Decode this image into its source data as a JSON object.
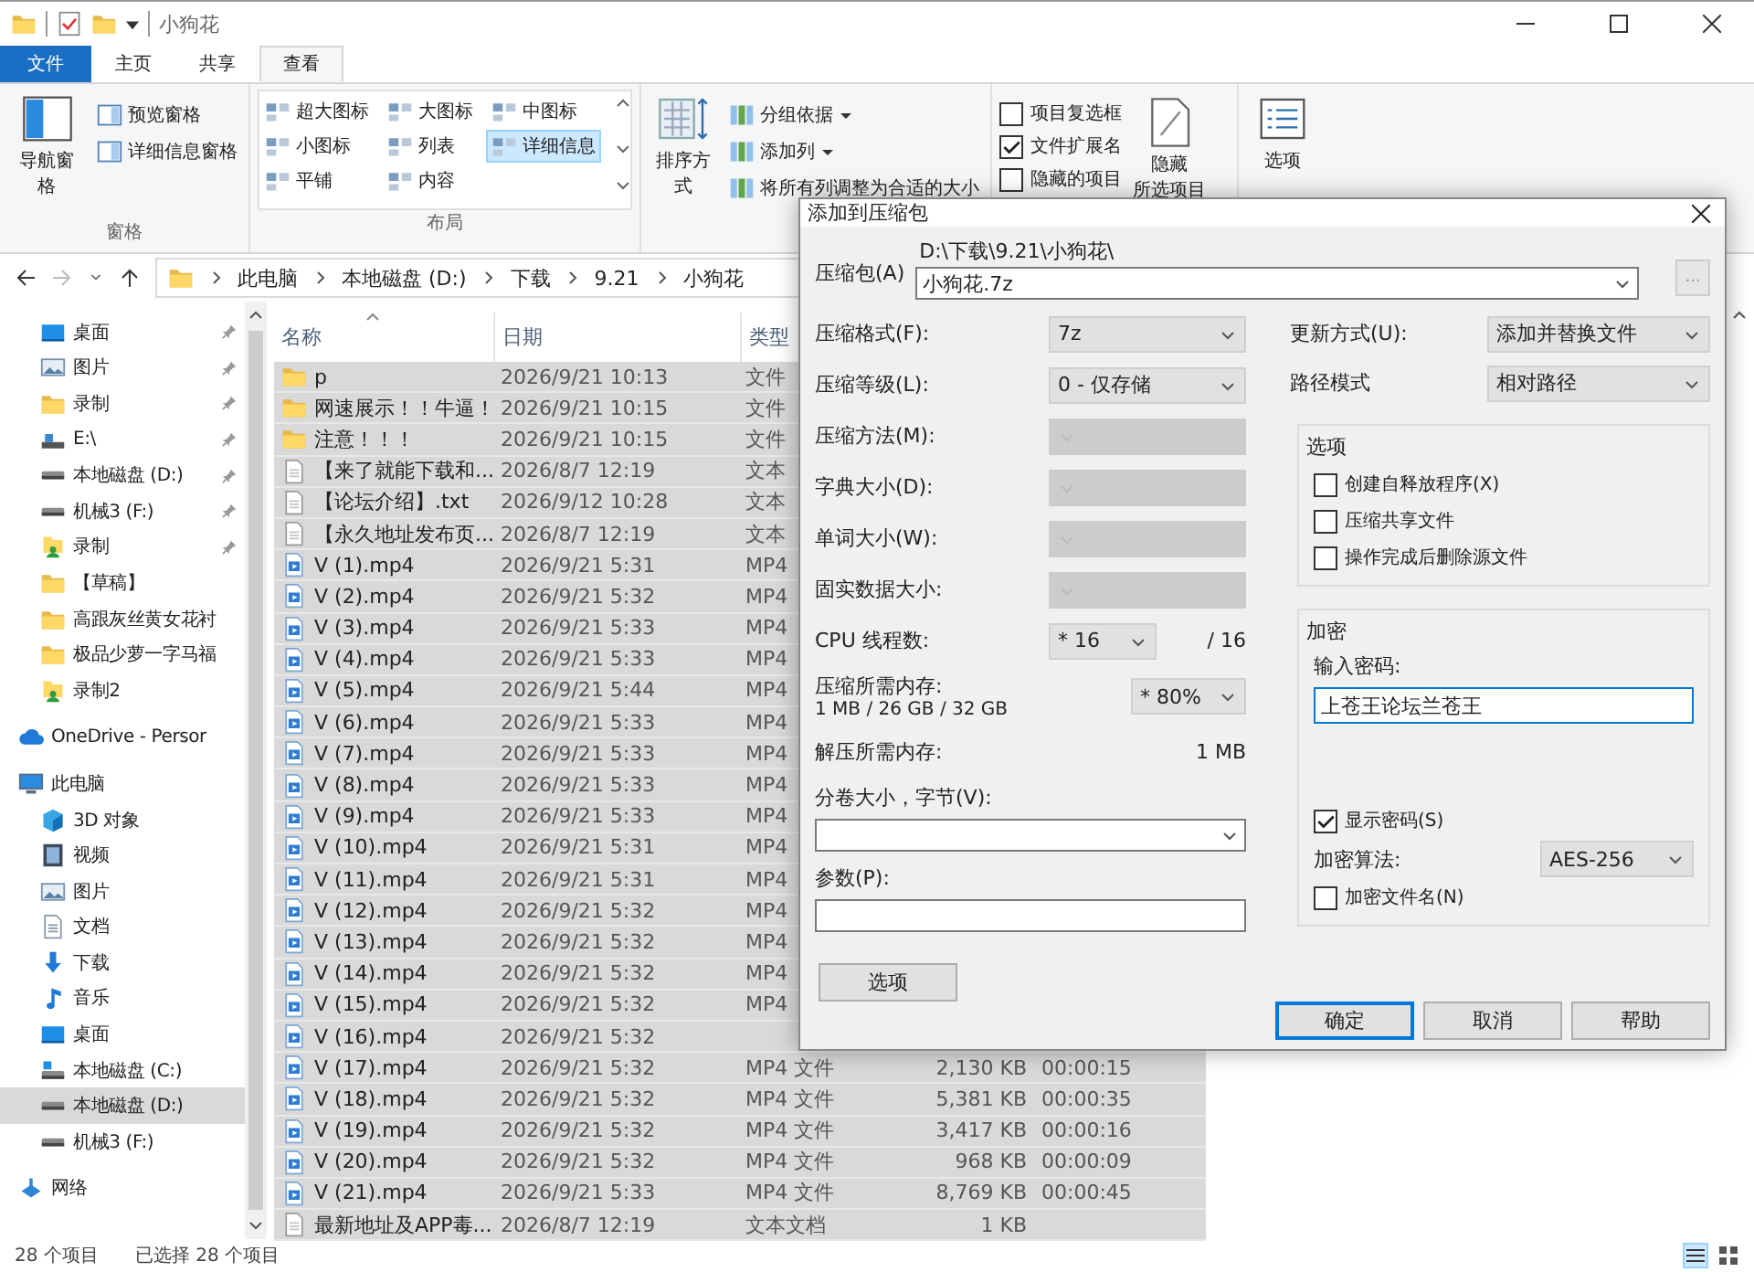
{
  "window": {
    "title": "小狗花"
  },
  "ribbon": {
    "tabs": [
      {
        "label": "文件",
        "kind": "file",
        "selected": false
      },
      {
        "label": "主页",
        "kind": "tab",
        "selected": false
      },
      {
        "label": "共享",
        "kind": "tab",
        "selected": false
      },
      {
        "label": "查看",
        "kind": "tab",
        "selected": true
      }
    ],
    "panes": {
      "label": "窗格",
      "large": "导航窗格",
      "items": [
        "预览窗格",
        "详细信息窗格"
      ]
    },
    "layout": {
      "label": "布局",
      "items": [
        {
          "label": "超大图标",
          "selected": false
        },
        {
          "label": "大图标",
          "selected": false
        },
        {
          "label": "中图标",
          "selected": false
        },
        {
          "label": "小图标",
          "selected": false
        },
        {
          "label": "列表",
          "selected": false
        },
        {
          "label": "详细信息",
          "selected": true
        },
        {
          "label": "平铺",
          "selected": false
        },
        {
          "label": "内容",
          "selected": false
        }
      ]
    },
    "current_view": {
      "sort": "排序方式",
      "items": [
        {
          "label": "分组依据",
          "dropdown": true
        },
        {
          "label": "添加列",
          "dropdown": true
        },
        {
          "label": "将所有列调整为合适的大小",
          "dropdown": false
        }
      ]
    },
    "show_hide": {
      "checkboxes": [
        {
          "label": "项目复选框",
          "checked": false
        },
        {
          "label": "文件扩展名",
          "checked": true
        },
        {
          "label": "隐藏的项目",
          "checked": false
        }
      ],
      "hide_button": [
        "隐藏",
        "所选项目"
      ]
    },
    "options": "选项"
  },
  "address": {
    "crumbs": [
      "此电脑",
      "本地磁盘 (D:)",
      "下载",
      "9.21",
      "小狗花"
    ]
  },
  "nav": {
    "quick_access": [
      {
        "label": "桌面",
        "kind": "desktop",
        "pinned": true,
        "selected": false
      },
      {
        "label": "图片",
        "kind": "pictures",
        "pinned": true,
        "selected": false
      },
      {
        "label": "录制",
        "kind": "folder",
        "pinned": true,
        "selected": false
      },
      {
        "label": "E:\\",
        "kind": "usb",
        "pinned": true,
        "selected": false
      },
      {
        "label": "本地磁盘 (D:)",
        "kind": "drive",
        "pinned": true,
        "selected": false
      },
      {
        "label": "机械3 (F:)",
        "kind": "drive",
        "pinned": true,
        "selected": false
      },
      {
        "label": "录制",
        "kind": "shared",
        "pinned": true,
        "selected": false
      },
      {
        "label": "【草稿】",
        "kind": "folder",
        "pinned": false,
        "selected": false
      },
      {
        "label": "高跟灰丝黄女花衬",
        "kind": "folder",
        "pinned": false,
        "selected": false
      },
      {
        "label": "极品少萝一字马福",
        "kind": "folder",
        "pinned": false,
        "selected": false
      },
      {
        "label": "录制2",
        "kind": "shared",
        "pinned": false,
        "selected": false
      }
    ],
    "tree": [
      {
        "label": "OneDrive - Persor",
        "kind": "cloud",
        "selected": false
      },
      {
        "label": "此电脑",
        "kind": "pc",
        "selected": false,
        "children": [
          {
            "label": "3D 对象",
            "kind": "cube",
            "selected": false
          },
          {
            "label": "视频",
            "kind": "film",
            "selected": false
          },
          {
            "label": "图片",
            "kind": "pictures",
            "selected": false
          },
          {
            "label": "文档",
            "kind": "document",
            "selected": false
          },
          {
            "label": "下载",
            "kind": "download",
            "selected": false
          },
          {
            "label": "音乐",
            "kind": "music",
            "selected": false
          },
          {
            "label": "桌面",
            "kind": "desktop",
            "selected": false
          },
          {
            "label": "本地磁盘 (C:)",
            "kind": "system",
            "selected": false
          },
          {
            "label": "本地磁盘 (D:)",
            "kind": "drive",
            "selected": true
          },
          {
            "label": "机械3 (F:)",
            "kind": "drive",
            "selected": false
          }
        ]
      },
      {
        "label": "网络",
        "kind": "network",
        "selected": false
      }
    ]
  },
  "files": {
    "columns": [
      {
        "label": "名称",
        "sorted": true
      },
      {
        "label": "日期",
        "sorted": false
      },
      {
        "label": "类型",
        "sorted": false
      }
    ],
    "rows": [
      {
        "name": "p",
        "kind": "folder",
        "date": "2026/9/21 10:13",
        "type": "文件",
        "selected": true
      },
      {
        "name": "网速展示！！牛逼！",
        "kind": "folder",
        "date": "2026/9/21 10:15",
        "type": "文件",
        "selected": true
      },
      {
        "name": "注意！！！",
        "kind": "folder",
        "date": "2026/9/21 10:15",
        "type": "文件",
        "selected": true
      },
      {
        "name": "【来了就能下载和...",
        "kind": "text",
        "date": "2026/8/7 12:19",
        "type": "文本",
        "selected": true
      },
      {
        "name": "【论坛介绍】.txt",
        "kind": "text",
        "date": "2026/9/12 10:28",
        "type": "文本",
        "selected": true
      },
      {
        "name": "【永久地址发布页...",
        "kind": "text",
        "date": "2026/8/7 12:19",
        "type": "文本",
        "selected": true
      },
      {
        "name": "V (1).mp4",
        "kind": "video",
        "date": "2026/9/21 5:31",
        "type": "MP4",
        "selected": true
      },
      {
        "name": "V (2).mp4",
        "kind": "video",
        "date": "2026/9/21 5:32",
        "type": "MP4",
        "selected": true
      },
      {
        "name": "V (3).mp4",
        "kind": "video",
        "date": "2026/9/21 5:33",
        "type": "MP4",
        "selected": true
      },
      {
        "name": "V (4).mp4",
        "kind": "video",
        "date": "2026/9/21 5:33",
        "type": "MP4",
        "selected": true
      },
      {
        "name": "V (5).mp4",
        "kind": "video",
        "date": "2026/9/21 5:44",
        "type": "MP4",
        "selected": true
      },
      {
        "name": "V (6).mp4",
        "kind": "video",
        "date": "2026/9/21 5:33",
        "type": "MP4",
        "selected": true
      },
      {
        "name": "V (7).mp4",
        "kind": "video",
        "date": "2026/9/21 5:33",
        "type": "MP4",
        "selected": true
      },
      {
        "name": "V (8).mp4",
        "kind": "video",
        "date": "2026/9/21 5:33",
        "type": "MP4",
        "selected": true
      },
      {
        "name": "V (9).mp4",
        "kind": "video",
        "date": "2026/9/21 5:33",
        "type": "MP4",
        "selected": true
      },
      {
        "name": "V (10).mp4",
        "kind": "video",
        "date": "2026/9/21 5:31",
        "type": "MP4",
        "selected": true
      },
      {
        "name": "V (11).mp4",
        "kind": "video",
        "date": "2026/9/21 5:31",
        "type": "MP4",
        "selected": true
      },
      {
        "name": "V (12).mp4",
        "kind": "video",
        "date": "2026/9/21 5:32",
        "type": "MP4",
        "selected": true
      },
      {
        "name": "V (13).mp4",
        "kind": "video",
        "date": "2026/9/21 5:32",
        "type": "MP4",
        "selected": true
      },
      {
        "name": "V (14).mp4",
        "kind": "video",
        "date": "2026/9/21 5:32",
        "type": "MP4",
        "selected": true
      },
      {
        "name": "V (15).mp4",
        "kind": "video",
        "date": "2026/9/21 5:32",
        "type": "MP4",
        "selected": true
      },
      {
        "name": "V (16).mp4",
        "kind": "video",
        "date": "2026/9/21 5:32",
        "selected": true
      },
      {
        "name": "V (17).mp4",
        "kind": "video",
        "date": "2026/9/21 5:32",
        "type": "MP4 文件",
        "size": "2,130 KB",
        "duration": "00:00:15",
        "selected": true
      },
      {
        "name": "V (18).mp4",
        "kind": "video",
        "date": "2026/9/21 5:32",
        "type": "MP4 文件",
        "size": "5,381 KB",
        "duration": "00:00:35",
        "selected": true
      },
      {
        "name": "V (19).mp4",
        "kind": "video",
        "date": "2026/9/21 5:32",
        "type": "MP4 文件",
        "size": "3,417 KB",
        "duration": "00:00:16",
        "selected": true
      },
      {
        "name": "V (20).mp4",
        "kind": "video",
        "date": "2026/9/21 5:32",
        "type": "MP4 文件",
        "size": "968 KB",
        "duration": "00:00:09",
        "selected": true
      },
      {
        "name": "V (21).mp4",
        "kind": "video",
        "date": "2026/9/21 5:33",
        "type": "MP4 文件",
        "size": "8,769 KB",
        "duration": "00:00:45",
        "selected": true
      },
      {
        "name": "最新地址及APP毒...",
        "kind": "text",
        "date": "2026/8/7 12:19",
        "type": "文本文档",
        "size": "1 KB",
        "selected": true
      }
    ]
  },
  "status_bar": {
    "count": "28 个项目",
    "selection": "已选择 28 个项目"
  },
  "dialog": {
    "title": "添加到压缩包",
    "archive": {
      "label": "压缩包(A)",
      "path": "D:\\下载\\9.21\\小狗花\\",
      "value": "小狗花.7z",
      "browse": "..."
    },
    "left_fields": [
      {
        "kind": "select",
        "label": "压缩格式(F):",
        "value": "7z",
        "disabled": false
      },
      {
        "kind": "select",
        "label": "压缩等级(L):",
        "value": "0 - 仅存储",
        "disabled": false
      },
      {
        "kind": "select",
        "label": "压缩方法(M):",
        "disabled": true
      },
      {
        "kind": "select",
        "label": "字典大小(D):",
        "disabled": true
      },
      {
        "kind": "select",
        "label": "单词大小(W):",
        "disabled": true
      },
      {
        "kind": "select",
        "label": "固实数据大小:",
        "disabled": true
      },
      {
        "kind": "threads",
        "label": "CPU 线程数:",
        "value": "* 16",
        "note": "/ 16",
        "disabled": false
      },
      {
        "kind": "memory",
        "label": "压缩所需内存:",
        "detail": "1 MB / 26 GB / 32 GB",
        "value": "* 80%",
        "disabled": false
      },
      {
        "kind": "info",
        "label": "解压所需内存:",
        "value": "1 MB"
      },
      {
        "kind": "combo",
        "label": "分卷大小，字节(V):"
      },
      {
        "kind": "input",
        "label": "参数(P):"
      }
    ],
    "options_button": "选项",
    "right_fields": [
      {
        "label": "更新方式(U):",
        "value": "添加并替换文件"
      },
      {
        "label": "路径模式",
        "value": "相对路径"
      }
    ],
    "options_group": {
      "title": "选项",
      "checkboxes": [
        {
          "label": "创建自释放程序(X)",
          "checked": false
        },
        {
          "label": "压缩共享文件",
          "checked": false
        },
        {
          "label": "操作完成后删除源文件",
          "checked": false
        }
      ]
    },
    "encryption": {
      "title": "加密",
      "password_label": "输入密码:",
      "password": "上苍王论坛兰苍王",
      "show_password": {
        "label": "显示密码(S)",
        "checked": true
      },
      "method_label": "加密算法:",
      "method": "AES-256",
      "encrypt_names": {
        "label": "加密文件名(N)",
        "checked": false
      }
    },
    "buttons": [
      {
        "label": "确定",
        "default": true
      },
      {
        "label": "取消",
        "default": false
      },
      {
        "label": "帮助",
        "default": false
      }
    ]
  }
}
